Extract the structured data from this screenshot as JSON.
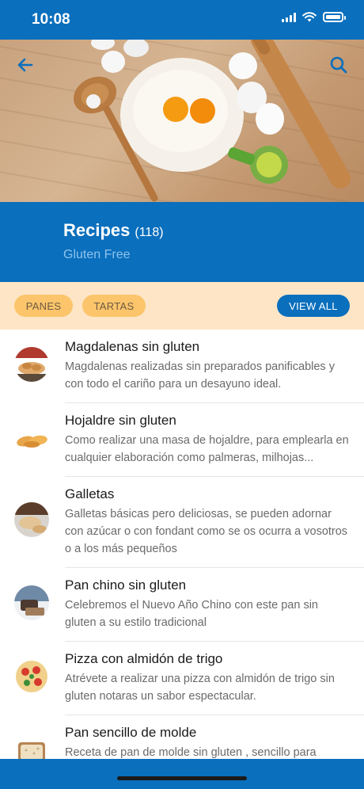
{
  "status_bar": {
    "time": "10:08"
  },
  "header": {
    "title": "Recipes",
    "count": "(118)",
    "subtitle": "Gluten Free"
  },
  "filters": {
    "chips": [
      "PANES",
      "TARTAS"
    ],
    "view_all": "VIEW ALL"
  },
  "recipes": [
    {
      "title": "Magdalenas sin gluten",
      "description": "Magdalenas realizadas sin preparados panificables y con todo el cariño para un desayuno ideal."
    },
    {
      "title": "Hojaldre sin gluten",
      "description": "Como realizar una masa de hojaldre, para emplearla en cualquier elaboración como palmeras, milhojas..."
    },
    {
      "title": "Galletas",
      "description": "Galletas básicas pero deliciosas, se pueden adornar con azúcar o con fondant como se os ocurra a vosotros o a los más pequeños"
    },
    {
      "title": "Pan chino sin gluten",
      "description": "Celebremos el Nuevo Año Chino con este pan sin gluten a su estilo tradicional"
    },
    {
      "title": "Pizza con almidón de trigo",
      "description": "Atrévete a realizar una pizza con almidón de trigo sin gluten notaras un sabor espectacular."
    },
    {
      "title": "Pan sencillo de molde",
      "description": "Receta de pan de molde sin gluten , sencillo para iniciarse en realizar nuestro pan en casa."
    }
  ],
  "colors": {
    "primary": "#0a6fbd",
    "filter_bg": "#fde5c6",
    "chip": "#fcc56b",
    "subtitle": "#8ec3ec"
  },
  "icons": [
    "wifi-icon",
    "signal-icon",
    "battery-icon",
    "back-arrow-icon",
    "search-icon"
  ]
}
